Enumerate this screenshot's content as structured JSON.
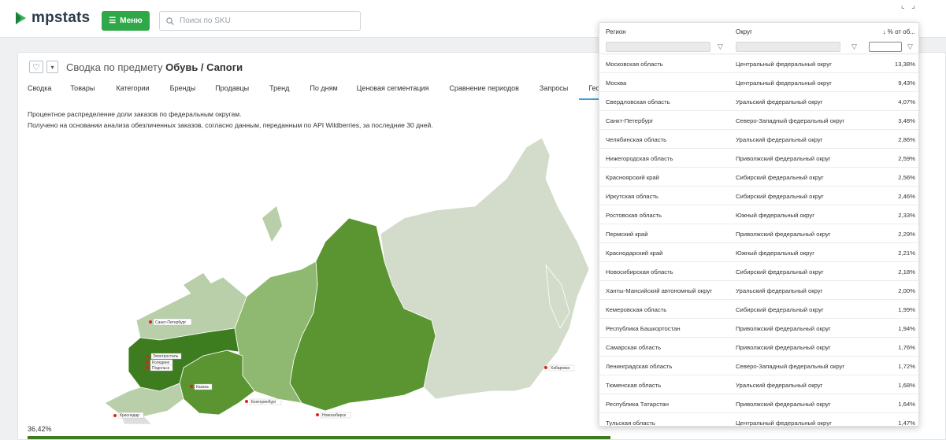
{
  "header": {
    "logo_text": "mpstats",
    "menu_label": "Меню",
    "search_placeholder": "Поиск по SKU",
    "corner_icons": "⌞ ⌟"
  },
  "page": {
    "title_prefix": "Сводка по предмету",
    "title_subject": "Обувь / Сапоги",
    "tabs": [
      {
        "label": "Сводка",
        "active": false
      },
      {
        "label": "Товары",
        "active": false
      },
      {
        "label": "Категории",
        "active": false
      },
      {
        "label": "Бренды",
        "active": false
      },
      {
        "label": "Продавцы",
        "active": false
      },
      {
        "label": "Тренд",
        "active": false
      },
      {
        "label": "По дням",
        "active": false
      },
      {
        "label": "Ценовая сегментация",
        "active": false
      },
      {
        "label": "Сравнение периодов",
        "active": false
      },
      {
        "label": "Запросы",
        "active": false
      },
      {
        "label": "География",
        "active": true
      }
    ],
    "description_line1": "Процентное распределение доли заказов по федеральным округам.",
    "description_line2": "Получено на основании анализа обезличенных заказов, согласно данным, переданным по API Wildberries, за последние 30 дней.",
    "legend_value": "36,42%"
  },
  "map": {
    "cities": [
      {
        "name": "Санкт-Петербург"
      },
      {
        "name": "Электросталь"
      },
      {
        "name": "Коледино"
      },
      {
        "name": "Подольск"
      },
      {
        "name": "Казань"
      },
      {
        "name": "Екатеринбург"
      },
      {
        "name": "Краснодар"
      },
      {
        "name": "Новосибирск"
      },
      {
        "name": "Хабаровск"
      }
    ],
    "colors": {
      "darkest": "#3e7d1f",
      "dark": "#5a9531",
      "medium": "#8fb870",
      "light": "#b9cfa9",
      "lightest": "#d3dcca",
      "none": "#dedede"
    }
  },
  "table": {
    "columns": {
      "region": "Регион",
      "district": "Округ",
      "percent": "↓ % от об..."
    },
    "rows": [
      {
        "region": "Московская область",
        "district": "Центральный федеральный округ",
        "percent": "13,38%"
      },
      {
        "region": "Москва",
        "district": "Центральный федеральный округ",
        "percent": "9,43%"
      },
      {
        "region": "Свердловская область",
        "district": "Уральский федеральный округ",
        "percent": "4,07%"
      },
      {
        "region": "Санкт-Петербург",
        "district": "Северо-Западный федеральный округ",
        "percent": "3,48%"
      },
      {
        "region": "Челябинская область",
        "district": "Уральский федеральный округ",
        "percent": "2,86%"
      },
      {
        "region": "Нижегородская область",
        "district": "Приволжский федеральный округ",
        "percent": "2,59%"
      },
      {
        "region": "Красноярский край",
        "district": "Сибирский федеральный округ",
        "percent": "2,56%"
      },
      {
        "region": "Иркутская область",
        "district": "Сибирский федеральный округ",
        "percent": "2,46%"
      },
      {
        "region": "Ростовская область",
        "district": "Южный федеральный округ",
        "percent": "2,33%"
      },
      {
        "region": "Пермский край",
        "district": "Приволжский федеральный округ",
        "percent": "2,29%"
      },
      {
        "region": "Краснодарский край",
        "district": "Южный федеральный округ",
        "percent": "2,21%"
      },
      {
        "region": "Новосибирская область",
        "district": "Сибирский федеральный округ",
        "percent": "2,18%"
      },
      {
        "region": "Ханты-Мансийский автономный округ",
        "district": "Уральский федеральный округ",
        "percent": "2,00%"
      },
      {
        "region": "Кемеровская область",
        "district": "Сибирский федеральный округ",
        "percent": "1,99%"
      },
      {
        "region": "Республика Башкортостан",
        "district": "Приволжский федеральный округ",
        "percent": "1,94%"
      },
      {
        "region": "Самарская область",
        "district": "Приволжский федеральный округ",
        "percent": "1,76%"
      },
      {
        "region": "Ленинградская область",
        "district": "Северо-Западный федеральный округ",
        "percent": "1,72%"
      },
      {
        "region": "Тюменская область",
        "district": "Уральский федеральный округ",
        "percent": "1,68%"
      },
      {
        "region": "Республика Татарстан",
        "district": "Приволжский федеральный округ",
        "percent": "1,64%"
      },
      {
        "region": "Тульская область",
        "district": "Центральный федеральный округ",
        "percent": "1,47%"
      }
    ]
  }
}
